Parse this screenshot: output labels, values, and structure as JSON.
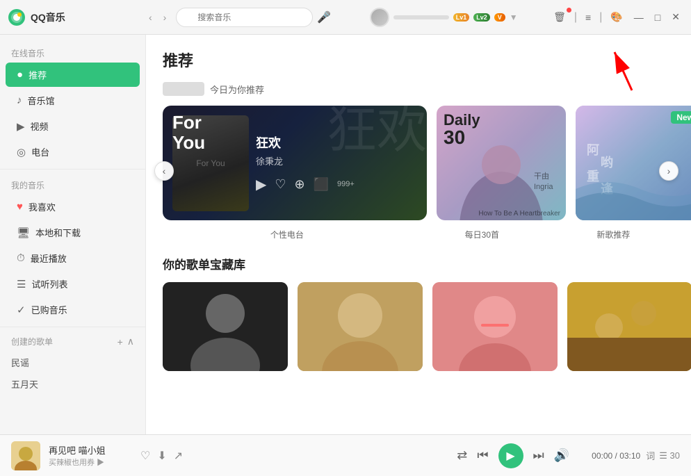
{
  "app": {
    "title": "QQ音乐",
    "logo_text": "QQ音乐"
  },
  "titlebar": {
    "search_placeholder": "搜索音乐",
    "level1": "Lv1",
    "level2": "Lv2",
    "vip": "V",
    "arrow_indicator": "↑",
    "window_controls": {
      "menu": "≡",
      "minimize": "—",
      "maximize": "□",
      "close": "✕",
      "skin": "🎨",
      "pin": "📌"
    }
  },
  "sidebar": {
    "online_music_label": "在线音乐",
    "items": [
      {
        "id": "recommend",
        "label": "推荐",
        "icon": "●"
      },
      {
        "id": "music-hall",
        "label": "音乐馆",
        "icon": "♪"
      },
      {
        "id": "video",
        "label": "视频",
        "icon": "▶"
      },
      {
        "id": "radio",
        "label": "电台",
        "icon": "◎"
      }
    ],
    "my_music_label": "我的音乐",
    "my_items": [
      {
        "id": "favorites",
        "label": "我喜欢",
        "icon": "♥"
      },
      {
        "id": "local",
        "label": "本地和下载",
        "icon": "🖥"
      },
      {
        "id": "recent",
        "label": "最近播放",
        "icon": "⏱"
      },
      {
        "id": "trial",
        "label": "试听列表",
        "icon": "☰"
      },
      {
        "id": "purchased",
        "label": "已购音乐",
        "icon": "✓"
      }
    ],
    "created_label": "创建的歌单",
    "add_btn": "+",
    "collapse_btn": "∧",
    "playlists": [
      {
        "id": "minyao",
        "label": "民谣"
      },
      {
        "id": "wuyuetian",
        "label": "五月天"
      }
    ]
  },
  "content": {
    "page_title": "推荐",
    "rec_subtitle": "今日为你推荐",
    "cards": {
      "foryou": {
        "title_for": "For",
        "title_you": "You",
        "kanji_bg": "狂欢",
        "song_name": "狂欢",
        "artist": "徐秉龙",
        "label": "个性电台"
      },
      "daily30": {
        "title": "Daily",
        "number": "30",
        "label": "每日30首",
        "subtitle_text": "干由\nIngria"
      },
      "newsong": {
        "badge": "New",
        "label": "新歌推荐"
      }
    },
    "playlist_section": {
      "title": "你的歌单宝藏库"
    }
  },
  "player": {
    "song_title": "再见吧 喵小姐",
    "promo": "买辣椒也用券 ▶",
    "time_current": "00:00",
    "time_total": "03:10",
    "lyrics_btn": "词",
    "list_count": "30",
    "shuffle_icon": "⇄",
    "prev_icon": "⏮",
    "play_icon": "▶",
    "next_icon": "⏭",
    "volume_icon": "🔊",
    "heart_icon": "♡",
    "download_icon": "⬇",
    "share_icon": "↗"
  },
  "colors": {
    "active_green": "#31c27c",
    "accent_red": "#ff4444"
  }
}
